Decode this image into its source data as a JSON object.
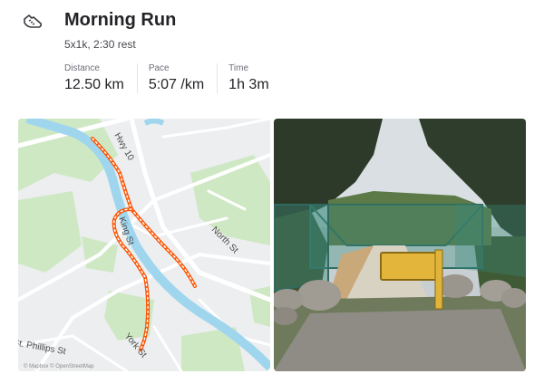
{
  "activity": {
    "icon": "running-shoe-icon",
    "title": "Morning Run",
    "description": "5x1k, 2:30 rest"
  },
  "stats": [
    {
      "label": "Distance",
      "value": "12.50 km"
    },
    {
      "label": "Pace",
      "value": "5:07 /km"
    },
    {
      "label": "Time",
      "value": "1h 3m"
    }
  ],
  "map": {
    "labels": {
      "hwy10": "Hwy 10",
      "king": "King St",
      "north": "North St",
      "york": "York St",
      "phillips": "St. Phillips St"
    },
    "copyright": "© Mapbox © OpenStreetMap",
    "route_color": "#fc5200"
  },
  "photo": {
    "description_icon": "trail-bridge-photo"
  }
}
